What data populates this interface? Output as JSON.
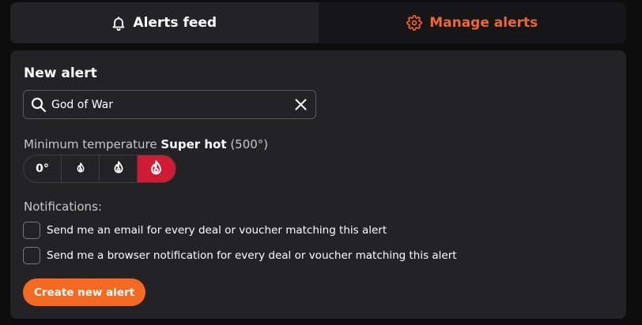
{
  "tabs": {
    "alerts_feed": {
      "label": "Alerts feed",
      "icon": "bell-icon"
    },
    "manage_alerts": {
      "label": "Manage alerts",
      "icon": "gear-icon"
    }
  },
  "new_alert": {
    "title": "New alert",
    "search": {
      "value": "God of War",
      "icon": "search-icon",
      "clear_icon": "close-icon"
    },
    "temperature": {
      "label_prefix": "Minimum temperature",
      "selected_name": "Super hot",
      "selected_value": "(500°)",
      "options": [
        {
          "label": "0°",
          "icon": null
        },
        {
          "label": "",
          "icon": "small-flame-icon"
        },
        {
          "label": "",
          "icon": "medium-flame-icon"
        },
        {
          "label": "",
          "icon": "large-flame-icon"
        }
      ],
      "selected_index": 3
    },
    "notifications": {
      "label": "Notifications:",
      "email": {
        "label": "Send me an email for every deal or voucher matching this alert",
        "checked": false
      },
      "browser": {
        "label": "Send me a browser notification for every deal or voucher matching this alert",
        "checked": false
      }
    },
    "create_button": "Create new alert"
  },
  "colors": {
    "accent_orange": "#f56a23",
    "hot_red": "#cf1b34",
    "panel_bg": "#232325",
    "page_bg": "#0d0d0d"
  }
}
